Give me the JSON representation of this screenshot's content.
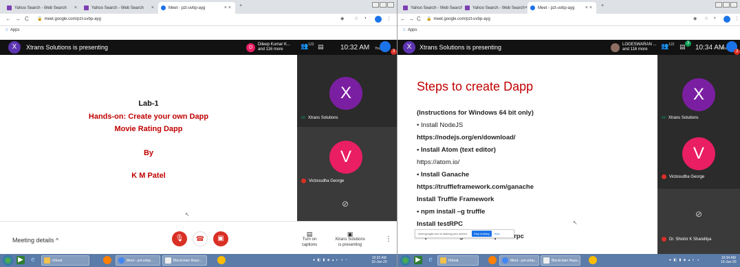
{
  "browser": {
    "tabs": [
      "Yahoo Search - Web Search",
      "Yahoo Search - Web Search",
      "Meet - pzt-uvbp-ayg"
    ],
    "url": "meet.google.com/pzt-uvbp-ayg",
    "bookmarks_label": "Apps"
  },
  "left": {
    "presenting": "Xtrans Solutions is presenting",
    "presenter_initial": "X",
    "chip_initial": "D",
    "chip_name": "Dileep Kumar K...",
    "chip_sub": "and 116 more",
    "people_count": "122",
    "clock": "10:32 AM",
    "you_label": "You",
    "you_badge": "3",
    "slide": {
      "line1": "Lab-1",
      "line2": "Hands-on: Create your own Dapp",
      "line3": "Movie Rating Dapp",
      "line4": "By",
      "line5": "K M Patel"
    },
    "tiles": [
      {
        "initial": "X",
        "name": "Xtrans Solutions"
      },
      {
        "initial": "V",
        "name": "Victosudha George"
      }
    ],
    "controls": {
      "meeting_details": "Meeting details",
      "captions": "Turn on captions",
      "presenting_line1": "Xtrans Solutions",
      "presenting_line2": "is presenting"
    }
  },
  "right": {
    "presenting": "Xtrans Solutions is presenting",
    "presenter_initial": "X",
    "chip_name": "LOGESWARAN ...",
    "chip_sub": "and 116 more",
    "people_count": "122",
    "chat_badge": "3",
    "clock": "10:34 AM",
    "you_label": "You",
    "you_badge": "3",
    "slide": {
      "title": "Steps to create Dapp",
      "steps": [
        "(Instructions for Windows 64 bit only)",
        "• Install NodeJS",
        "https://nodejs.org/en/download/",
        "• Install Atom (text editor)",
        "https://atom.io/",
        "• Install Ganache",
        "https://truffleframework.com/ganache",
        "Install Truffle Framework",
        "• npm install –g truffle",
        "Install testRPC",
        "• npm install -g ethereumjs-testrpc"
      ]
    },
    "tiles": [
      {
        "initial": "X",
        "name": "Xtrans Solutions"
      },
      {
        "initial": "V",
        "name": "Victosudha George"
      },
      {
        "initial": "",
        "name": "Dr. Shishir K Shandilya"
      }
    ],
    "share_bar": {
      "text": "meet.google.com is sharing your screen.",
      "stop": "Stop sharing",
      "hide": "Hide"
    }
  },
  "taskbar": {
    "left_buttons": [
      "iXtreat",
      "Meet - pzt-uvbp...",
      "Blockchain Repo..."
    ],
    "left_time": "10:32 AM",
    "left_date": "10-Jun-20",
    "right_buttons": [
      "iXtreat",
      "Meet - pzt-uvbp...",
      "Blockchain Repo..."
    ],
    "right_time": "10:34 AM",
    "right_date": "10-Jun-20"
  },
  "colors": {
    "slide_red": "#c00000",
    "purple_avatar": "#7b1fa2",
    "pink_avatar": "#e91e63",
    "meet_dark": "#121212",
    "end_call": "#d93025"
  },
  "icons": [
    "search-icon",
    "mic-off-icon",
    "end-call-icon",
    "camera-off-icon",
    "captions-icon",
    "present-icon",
    "more-icon",
    "people-icon",
    "chat-icon"
  ]
}
